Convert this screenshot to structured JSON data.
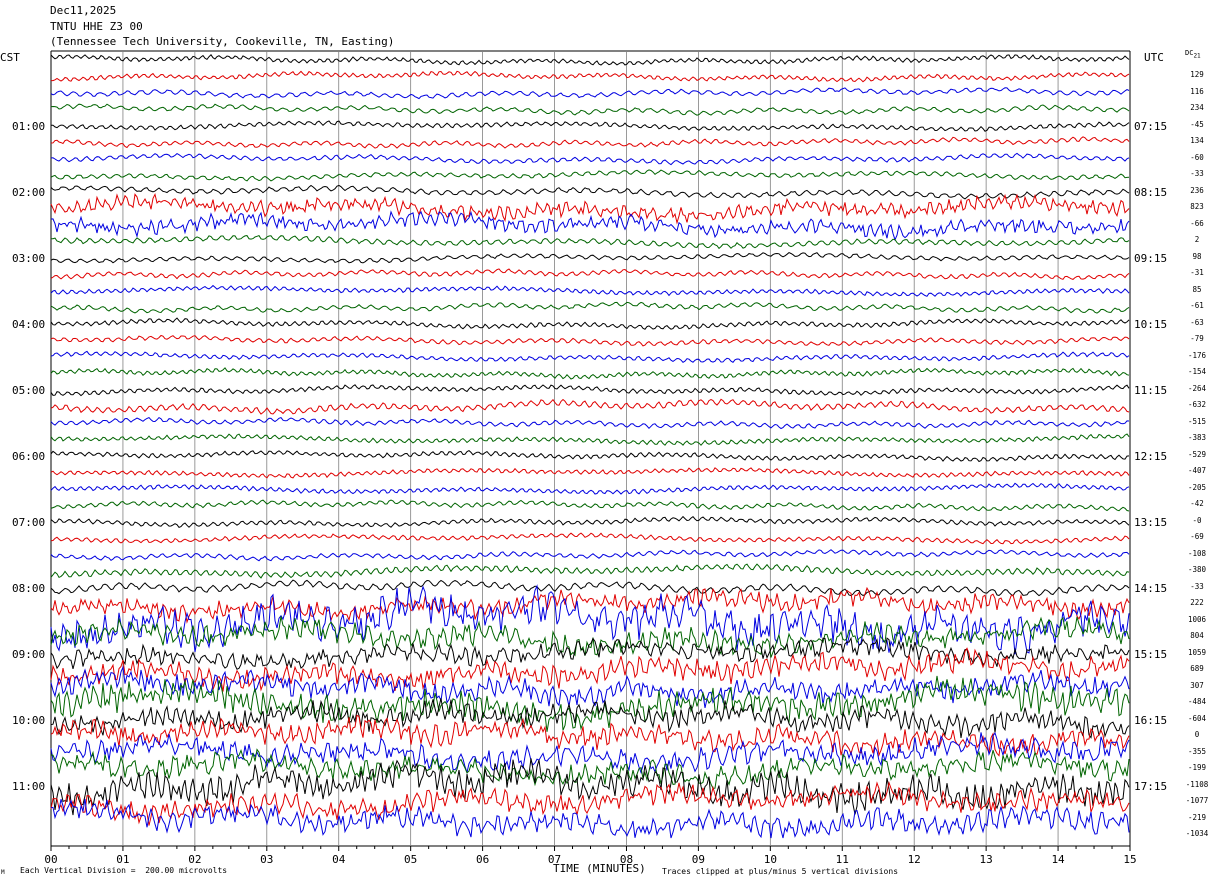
{
  "header": {
    "date": "Dec11,2025",
    "station": "TNTU HHE Z3 00",
    "location": "(Tennessee Tech University, Cookeville, TN, Easting)"
  },
  "left_tz": "CST",
  "right_tz": "UTC",
  "dc_title": "DC",
  "dc_sub": "21",
  "footer": {
    "mark": "M",
    "division": "Each Vertical Division =  200.00 microvolts",
    "xlabel": "TIME (MINUTES)",
    "clip_note": "Traces clipped at plus/minus 5 vertical divisions"
  },
  "chart_data": {
    "type": "line",
    "title": "TNTU HHE Z3 00",
    "xlabel": "TIME (MINUTES)",
    "xlim": [
      0,
      15
    ],
    "x_ticks": [
      "00",
      "01",
      "02",
      "03",
      "04",
      "05",
      "06",
      "07",
      "08",
      "09",
      "10",
      "11",
      "12",
      "13",
      "14",
      "15"
    ],
    "grid": "vertical lines each minute",
    "trace_colors": [
      "#000000",
      "#e00000",
      "#0000e0",
      "#006400"
    ],
    "left_time_labels": [
      {
        "row": 4,
        "text": "01:00"
      },
      {
        "row": 8,
        "text": "02:00"
      },
      {
        "row": 12,
        "text": "03:00"
      },
      {
        "row": 16,
        "text": "04:00"
      },
      {
        "row": 20,
        "text": "05:00"
      },
      {
        "row": 24,
        "text": "06:00"
      },
      {
        "row": 28,
        "text": "07:00"
      },
      {
        "row": 32,
        "text": "08:00"
      },
      {
        "row": 36,
        "text": "09:00"
      },
      {
        "row": 40,
        "text": "10:00"
      },
      {
        "row": 44,
        "text": "11:00"
      }
    ],
    "right_time_labels": [
      {
        "row": 4,
        "text": "07:15"
      },
      {
        "row": 8,
        "text": "08:15"
      },
      {
        "row": 12,
        "text": "09:15"
      },
      {
        "row": 16,
        "text": "10:15"
      },
      {
        "row": 20,
        "text": "11:15"
      },
      {
        "row": 24,
        "text": "12:15"
      },
      {
        "row": 28,
        "text": "13:15"
      },
      {
        "row": 32,
        "text": "14:15"
      },
      {
        "row": 36,
        "text": "15:15"
      },
      {
        "row": 40,
        "text": "16:15"
      },
      {
        "row": 44,
        "text": "17:15"
      }
    ],
    "dc_offsets": [
      "129",
      "116",
      "234",
      "-45",
      "134",
      "-60",
      "-33",
      "236",
      "823",
      "-66",
      "2",
      "98",
      "-31",
      "85",
      "-61",
      "-63",
      "-79",
      "-176",
      "-154",
      "-264",
      "-632",
      "-515",
      "-383",
      "-529",
      "-407",
      "-205",
      "-42",
      "-0",
      "-69",
      "-108",
      "-380",
      "-33",
      "222",
      "1006",
      "804",
      "1059",
      "689",
      "307",
      "-484",
      "-604",
      "0",
      "-355",
      "-199",
      "-1108",
      "-1077",
      "-219",
      "-1034"
    ],
    "trace_activity": [
      1,
      1,
      1,
      1,
      1,
      1,
      1,
      1,
      1.2,
      2,
      2,
      1.2,
      1,
      1,
      1,
      1,
      1,
      1,
      1,
      1,
      1,
      1.4,
      1,
      1,
      1,
      1,
      1,
      1,
      1,
      1,
      1,
      1.4,
      1.5,
      2.5,
      5,
      3,
      2.5,
      3,
      3,
      4,
      3,
      3,
      3,
      3,
      4,
      3,
      3
    ]
  }
}
